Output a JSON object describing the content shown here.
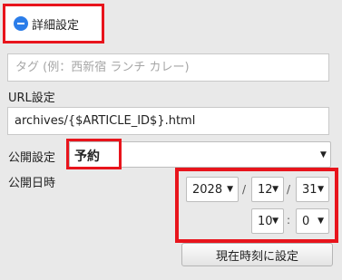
{
  "details": {
    "label": "詳細設定"
  },
  "tag": {
    "placeholder": "タグ (例：西新宿 ランチ カレー)"
  },
  "url": {
    "label": "URL設定",
    "value": "archives/{$ARTICLE_ID$}.html"
  },
  "status": {
    "label": "公開設定",
    "value": "予約"
  },
  "publish_date": {
    "label": "公開日時",
    "year": "2028",
    "month": "12",
    "day": "31",
    "hour": "10",
    "minute": "0",
    "date_separator": "/",
    "time_separator": ":"
  },
  "set_now_button": {
    "label": "現在時刻に設定"
  },
  "colors": {
    "highlight": "#e8141c",
    "toggle_icon": "#2b7de9"
  },
  "icons": {
    "toggle": "minus-circle-icon",
    "dropdown": "caret-down-icon"
  }
}
